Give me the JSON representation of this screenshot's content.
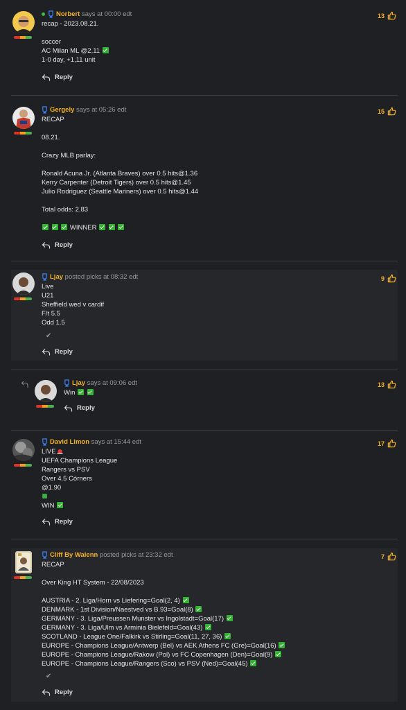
{
  "posts": [
    {
      "author": "Norbert",
      "meta": "says at 00:00 edt",
      "likes": "13",
      "lines": [
        "recap - 2023.08.21.",
        "",
        "soccer",
        "AC Milan ML @2,11",
        "1-0 day, +1,11 unit"
      ],
      "reply_label": "Reply"
    },
    {
      "author": "Gergely",
      "meta": "says at 05:26 edt",
      "likes": "15",
      "lines": [
        "RECAP",
        "",
        "08.21.",
        "",
        "Crazy MLB parlay:",
        "",
        "Ronald Acuna Jr. (Atlanta Braves) over 0.5 hits@1.36",
        "Kerry Carpenter (Detroit Tigers) over 0.5 hits@1.45",
        "Julio Rodriguez (Seattle Mariners) over 0.5 hits@1.44",
        "",
        "Total odds: 2.83",
        "",
        "WINNER"
      ],
      "reply_label": "Reply"
    },
    {
      "author": "Ljay",
      "meta": "posted picks at 08:32 edt",
      "likes": "9",
      "lines": [
        "Live",
        "U21",
        "Sheffield wed v cardif",
        "F/t 5.5",
        "Odd 1.5"
      ],
      "reply_label": "Reply"
    },
    {
      "author": "Ljay",
      "meta": "says at 09:06 edt",
      "likes": "13",
      "lines": [
        "Win"
      ],
      "reply_label": "Reply"
    },
    {
      "author": "David Limon",
      "meta": "says at 15:44 edt",
      "likes": "17",
      "lines": [
        "LIVE",
        "UEFA Champions League",
        "Rangers vs PSV",
        "Over 4.5 Córners",
        "@1.90",
        "",
        "WIN"
      ],
      "reply_label": "Reply"
    },
    {
      "author": "Cliff By Walenn",
      "meta": "posted picks at 23:32 edt",
      "likes": "7",
      "lines": [
        "RECAP",
        "",
        "Over King HT System - 22/08/2023",
        "",
        "AUSTRIA - 2. Liga/Horn vs Liefering=Goal(2, 4)",
        "DENMARK - 1st Division/Naestved vs B.93=Goal(8)",
        "GERMANY - 3. Liga/Preussen Munster vs Ingolstadt=Goal(17)",
        "GERMANY - 3. Liga/Ulm vs Arminia Bielefeld=Goal(43)",
        "SCOTLAND - League One/Falkirk vs Stirling=Goal(11, 27, 36)",
        "EUROPE - Champions League/Antwerp (Bel) vs AEK Athens FC (Gre)=Goal(16)",
        "EUROPE - Champions League/Rakow (Pol) vs FC Copenhagen (Den)=Goal(9)",
        "EUROPE - Champions League/Rangers (Sco) vs PSV (Ned)=Goal(45)"
      ],
      "reply_label": "Reply"
    }
  ]
}
